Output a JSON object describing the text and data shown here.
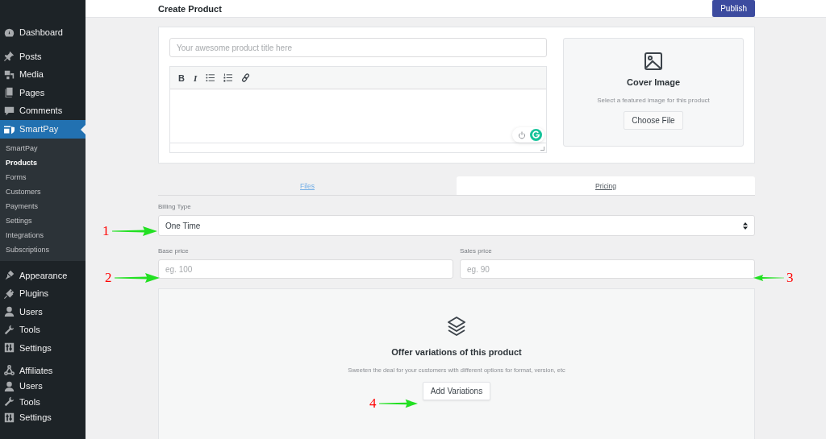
{
  "sidebar": {
    "groups": [
      {
        "items": [
          {
            "label": "Dashboard",
            "selected": false
          }
        ]
      },
      {
        "items": [
          {
            "label": "Posts",
            "selected": false
          },
          {
            "label": "Media",
            "selected": false
          },
          {
            "label": "Pages",
            "selected": false
          },
          {
            "label": "Comments",
            "selected": false
          },
          {
            "label": "SmartPay",
            "selected": true,
            "children": [
              {
                "label": "SmartPay",
                "selected": false
              },
              {
                "label": "Products",
                "selected": true
              },
              {
                "label": "Forms",
                "selected": false
              },
              {
                "label": "Customers",
                "selected": false
              },
              {
                "label": "Payments",
                "selected": false
              },
              {
                "label": "Settings",
                "selected": false
              },
              {
                "label": "Integrations",
                "selected": false
              },
              {
                "label": "Subscriptions",
                "selected": false
              }
            ]
          }
        ]
      },
      {
        "items": [
          {
            "label": "Appearance",
            "selected": false
          },
          {
            "label": "Plugins",
            "selected": false
          },
          {
            "label": "Users",
            "selected": false
          },
          {
            "label": "Tools",
            "selected": false
          },
          {
            "label": "Settings",
            "selected": false
          }
        ]
      },
      {
        "items": [
          {
            "label": "Affiliates",
            "selected": false
          },
          {
            "label": "Users",
            "selected": false
          },
          {
            "label": "Tools",
            "selected": false
          },
          {
            "label": "Settings",
            "selected": false
          }
        ]
      }
    ]
  },
  "header": {
    "title": "Create Product",
    "publish_button": "Publish"
  },
  "product": {
    "title_placeholder": "Your awesome product title here",
    "toolbar": [
      {
        "kind": "text",
        "label": "B"
      },
      {
        "kind": "text",
        "label": "I"
      },
      {
        "kind": "bullets"
      },
      {
        "kind": "numbers"
      },
      {
        "kind": "link"
      }
    ],
    "cover": {
      "title": "Cover Image",
      "hint": "Select a featured image for this product",
      "button": "Choose File"
    }
  },
  "tabs": [
    {
      "label": "Files",
      "selected": false
    },
    {
      "label": "Pricing",
      "selected": true
    }
  ],
  "billing": {
    "label": "Billing Type",
    "value": "One Time"
  },
  "prices": [
    {
      "label": "Base price",
      "placeholder": "eg. 100"
    },
    {
      "label": "Sales price",
      "placeholder": "eg. 90"
    }
  ],
  "variations": {
    "title": "Offer variations of this product",
    "hint": "Sweeten the deal for your customers with different options for format, version, etc",
    "button": "Add Variations"
  },
  "annotations": [
    {
      "label": "1",
      "kind": "right"
    },
    {
      "label": "2",
      "kind": "right"
    },
    {
      "label": "3",
      "kind": "left"
    },
    {
      "label": "4",
      "kind": "right"
    }
  ]
}
